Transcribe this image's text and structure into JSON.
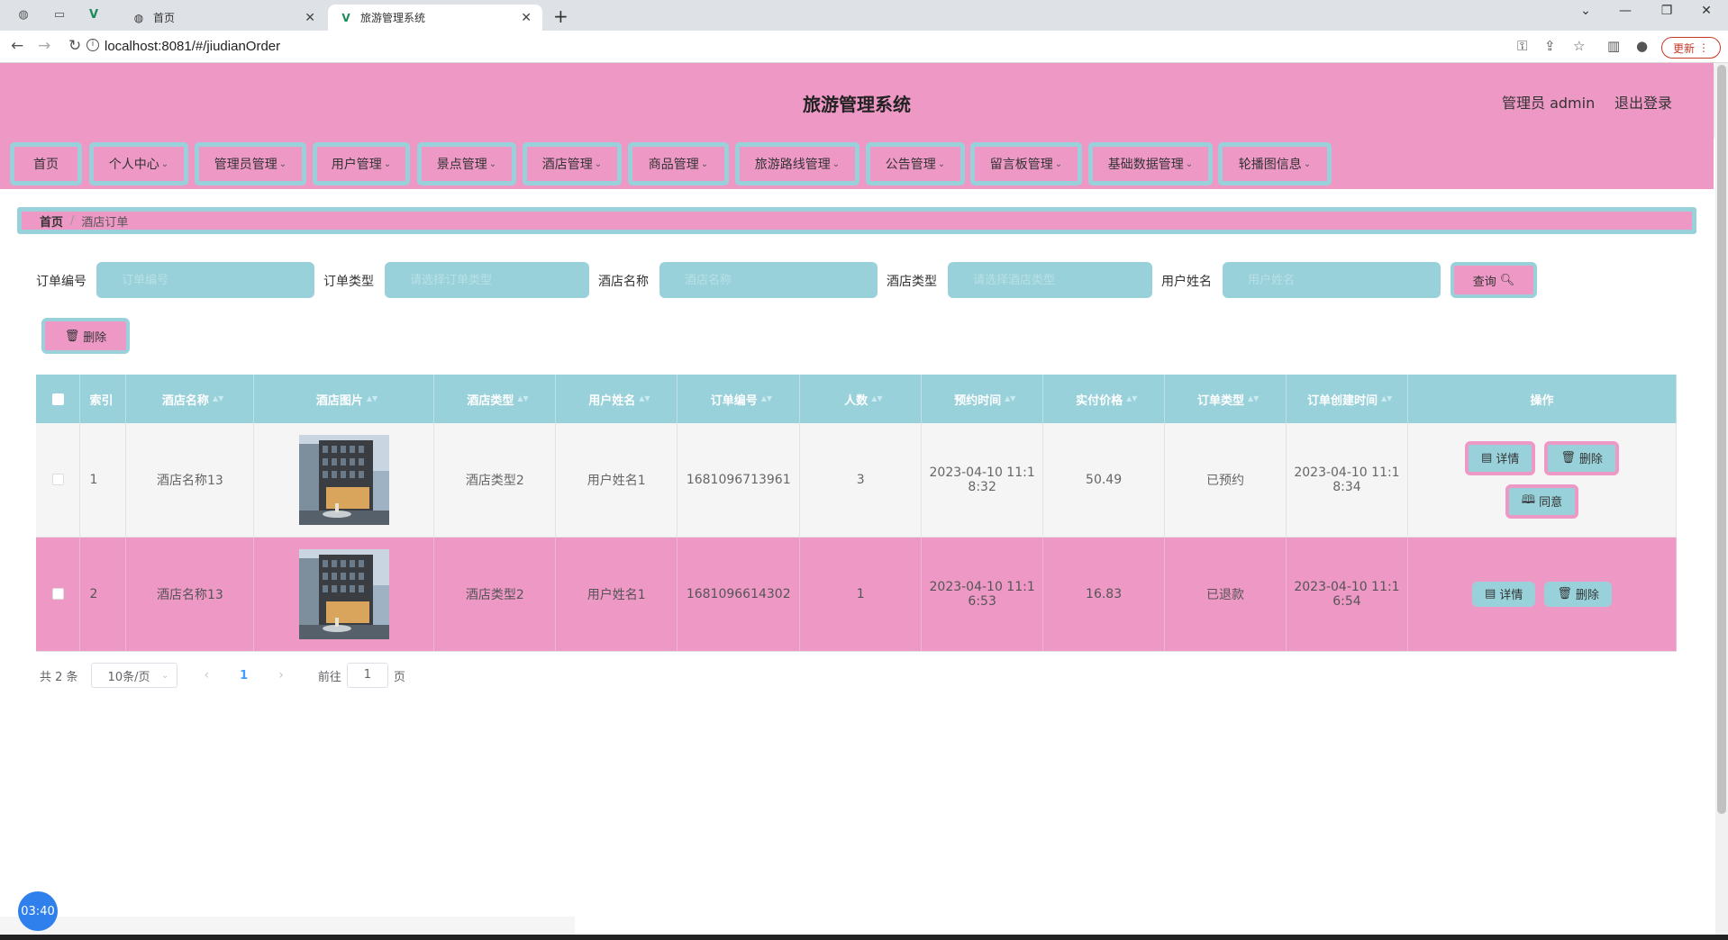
{
  "browser": {
    "tabs": [
      {
        "title": "首页",
        "active": false
      },
      {
        "title": "旅游管理系统",
        "active": true
      }
    ],
    "url": "localhost:8081/#/jiudianOrder",
    "update_label": "更新"
  },
  "header": {
    "title": "旅游管理系统",
    "user": "管理员 admin",
    "logout": "退出登录"
  },
  "menu": [
    {
      "label": "首页",
      "dropdown": false
    },
    {
      "label": "个人中心",
      "dropdown": true
    },
    {
      "label": "管理员管理",
      "dropdown": true
    },
    {
      "label": "用户管理",
      "dropdown": true
    },
    {
      "label": "景点管理",
      "dropdown": true
    },
    {
      "label": "酒店管理",
      "dropdown": true
    },
    {
      "label": "商品管理",
      "dropdown": true
    },
    {
      "label": "旅游路线管理",
      "dropdown": true
    },
    {
      "label": "公告管理",
      "dropdown": true
    },
    {
      "label": "留言板管理",
      "dropdown": true
    },
    {
      "label": "基础数据管理",
      "dropdown": true
    },
    {
      "label": "轮播图信息",
      "dropdown": true
    }
  ],
  "breadcrumb": {
    "home": "首页",
    "separator": "/",
    "current": "酒店订单"
  },
  "search": {
    "fields": [
      {
        "label": "订单编号",
        "placeholder": "订单编号"
      },
      {
        "label": "订单类型",
        "placeholder": "请选择订单类型"
      },
      {
        "label": "酒店名称",
        "placeholder": "酒店名称"
      },
      {
        "label": "酒店类型",
        "placeholder": "请选择酒店类型"
      },
      {
        "label": "用户姓名",
        "placeholder": "用户姓名"
      }
    ],
    "query_label": "查询",
    "delete_label": "删除"
  },
  "table": {
    "headers": [
      "索引",
      "酒店名称",
      "酒店图片",
      "酒店类型",
      "用户姓名",
      "订单编号",
      "人数",
      "预约时间",
      "实付价格",
      "订单类型",
      "订单创建时间",
      "操作"
    ],
    "rows": [
      {
        "index": "1",
        "hotel_name": "酒店名称13",
        "hotel_type": "酒店类型2",
        "user_name": "用户姓名1",
        "order_no": "1681096713961",
        "people": "3",
        "reserve_time_l1": "2023-04-10 11:1",
        "reserve_time_l2": "8:32",
        "price": "50.49",
        "order_type": "已预约",
        "created_l1": "2023-04-10 11:1",
        "created_l2": "8:34",
        "actions": [
          "详情",
          "删除",
          "同意"
        ]
      },
      {
        "index": "2",
        "hotel_name": "酒店名称13",
        "hotel_type": "酒店类型2",
        "user_name": "用户姓名1",
        "order_no": "1681096614302",
        "people": "1",
        "reserve_time_l1": "2023-04-10 11:1",
        "reserve_time_l2": "6:53",
        "price": "16.83",
        "order_type": "已退款",
        "created_l1": "2023-04-10 11:1",
        "created_l2": "6:54",
        "actions": [
          "详情",
          "删除"
        ]
      }
    ]
  },
  "pagination": {
    "total": "共 2 条",
    "page_size": "10条/页",
    "current_page": "1",
    "goto_label": "前往",
    "goto_value": "1",
    "page_suffix": "页"
  },
  "timer": "03:40",
  "colors": {
    "pink": "#ee98c6",
    "teal": "#99d1da"
  }
}
